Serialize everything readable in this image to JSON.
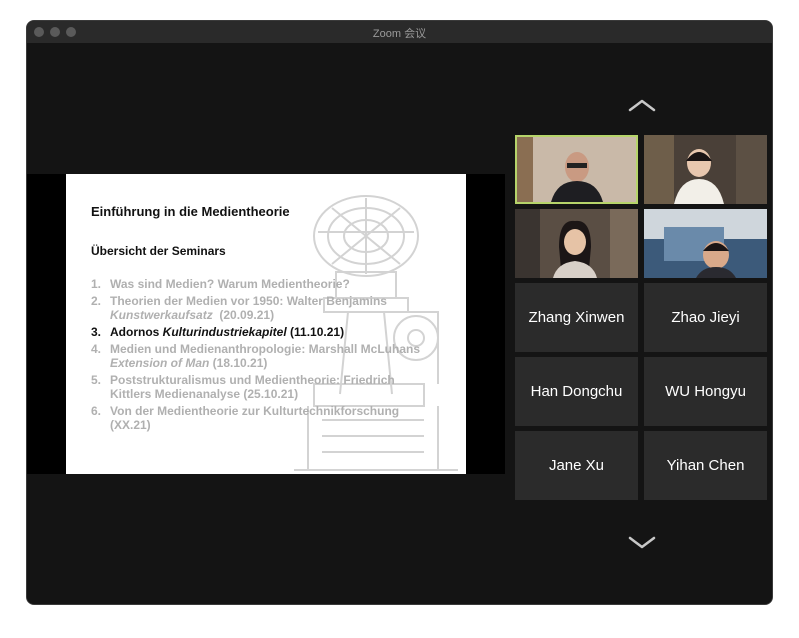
{
  "window": {
    "title": "Zoom 会议"
  },
  "slide": {
    "title": "Einführung in die Medientheorie",
    "subtitle": "Übersicht der Seminars",
    "items": [
      {
        "num": "1.",
        "line1": "Was sind Medien? Warum Medientheorie?",
        "line2_italic": "",
        "line2_plain": ""
      },
      {
        "num": "2.",
        "line1": "Theorien der Medien vor 1950: Walter Benjamins",
        "line2_italic": "Kunstwerkaufsatz",
        "line2_plain": "  (20.09.21)"
      },
      {
        "num": "3.",
        "pre": "Adornos ",
        "italic": "Kulturindustriekapitel",
        "post": " (11.10.21)"
      },
      {
        "num": "4.",
        "line1": "Medien und Medienanthropologie: Marshall McLuhans",
        "line2_italic": "Extension of Man",
        "line2_plain": " (18.10.21)"
      },
      {
        "num": "5.",
        "line1": "Poststrukturalismus und Medientheorie: Friedrich",
        "line2_italic": "",
        "line2_plain": "Kittlers Medienanalyse (25.10.21)"
      },
      {
        "num": "6.",
        "line1": "Von der Medientheorie zur Kulturtechnikforschung",
        "line2_italic": "",
        "line2_plain": "(XX.21)"
      }
    ]
  },
  "participants": [
    {
      "name": "Zhang Xinwen"
    },
    {
      "name": "Zhao Jieyi"
    },
    {
      "name": "Han Dongchu"
    },
    {
      "name": "WU Hongyu"
    },
    {
      "name": "Jane Xu"
    },
    {
      "name": "Yihan Chen"
    }
  ],
  "icons": {
    "scroll_up": "chevron-up-icon",
    "scroll_down": "chevron-down-icon"
  },
  "colors": {
    "active_speaker_border": "#b6d46a",
    "window_bg": "#1a1a1a",
    "tile_bg": "#2b2b2b"
  }
}
